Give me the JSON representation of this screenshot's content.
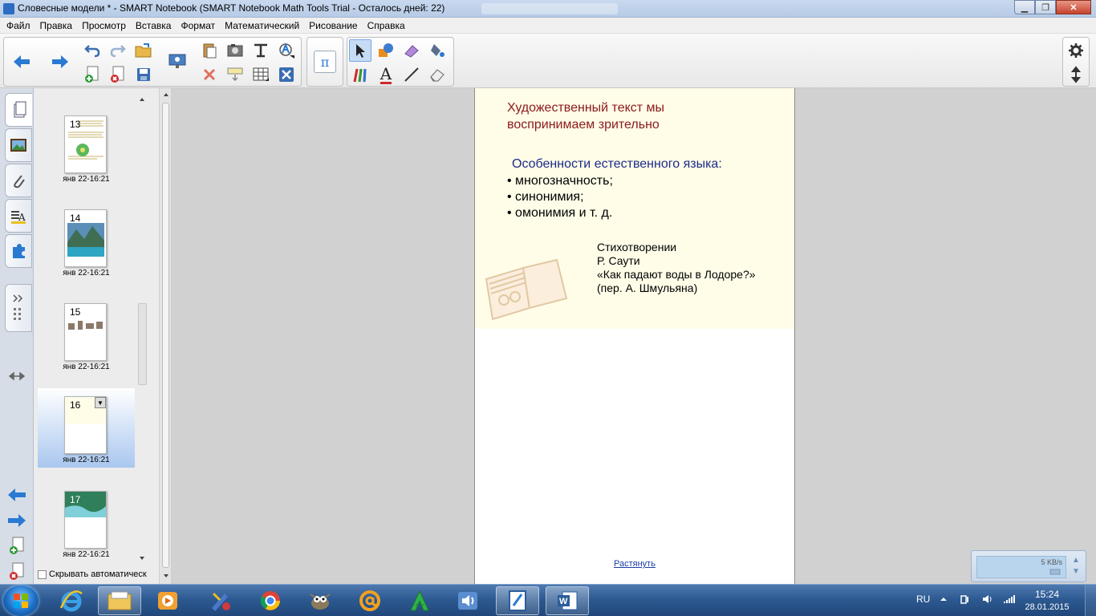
{
  "window": {
    "title": "Словесные модели * - SMART Notebook (SMART Notebook Math Tools Trial - Осталось дней: 22)",
    "controls": {
      "minimize": "▁",
      "maximize": "❐",
      "close": "✕"
    }
  },
  "menu": [
    "Файл",
    "Правка",
    "Просмотр",
    "Вставка",
    "Формат",
    "Математический",
    "Рисование",
    "Справка"
  ],
  "toolbar": {
    "icons": {
      "back": "back-arrow-icon",
      "forward": "forward-arrow-icon",
      "undo": "undo-icon",
      "redo": "redo-icon",
      "add_page": "add-page-icon",
      "delete_page": "delete-page-icon",
      "open": "open-folder-icon",
      "save": "save-icon",
      "screen": "screen-shade-icon",
      "paste": "paste-icon",
      "screen_capture": "screen-capture-icon",
      "clear": "clear-icon",
      "show_hide": "screen-shade-toggle-icon",
      "table": "table-icon",
      "text_tool": "text-cursor-icon",
      "math": "math-pi-icon",
      "select": "select-cursor-icon",
      "shapes": "shapes-icon",
      "creative_pen": "creative-pen-icon",
      "fill": "fill-icon",
      "pens": "pens-icon",
      "text": "text-icon",
      "line": "line-icon",
      "eraser": "eraser-icon",
      "settings": "gear-icon",
      "move_toolbar": "move-toolbar-icon"
    },
    "glyphs": {
      "math": "π",
      "text": "A"
    }
  },
  "sidebar": {
    "tabs": [
      "page-sorter-icon",
      "gallery-icon",
      "attachments-icon",
      "properties-icon",
      "addons-icon"
    ],
    "autohide_label": "Скрывать автоматическ"
  },
  "pages": [
    {
      "number": "13",
      "date": "янв 22-16:21",
      "selected": false
    },
    {
      "number": "14",
      "date": "янв 22-16:21",
      "selected": false
    },
    {
      "number": "15",
      "date": "янв 22-16:21",
      "selected": false
    },
    {
      "number": "16",
      "date": "янв 22-16:21",
      "selected": true
    },
    {
      "number": "17",
      "date": "янв 22-16:21",
      "selected": false
    }
  ],
  "slide": {
    "heading": "Художественный текст мы воспринимаем зрительно",
    "subheading": "Особенности естественного языка:",
    "bullets": [
      "• многозначность;",
      "• синонимия;",
      "• омонимия и т. д."
    ],
    "poem": [
      "Стихотворении",
      "Р. Саути",
      "«Как падают воды в Лодоре?»",
      "(пер. А. Шмульяна)"
    ],
    "stretch_link": "Растянуть"
  },
  "network_widget": {
    "speed": "5 KB/s"
  },
  "taskbar": {
    "apps": [
      "internet-explorer-icon",
      "file-explorer-icon",
      "media-player-icon",
      "paint-icon",
      "chrome-icon",
      "gimp-icon",
      "mail-icon",
      "green-a-icon",
      "speaker-app-icon",
      "smart-notebook-icon",
      "word-icon"
    ],
    "language": "RU",
    "time": "15:24",
    "date": "28.01.2015"
  }
}
